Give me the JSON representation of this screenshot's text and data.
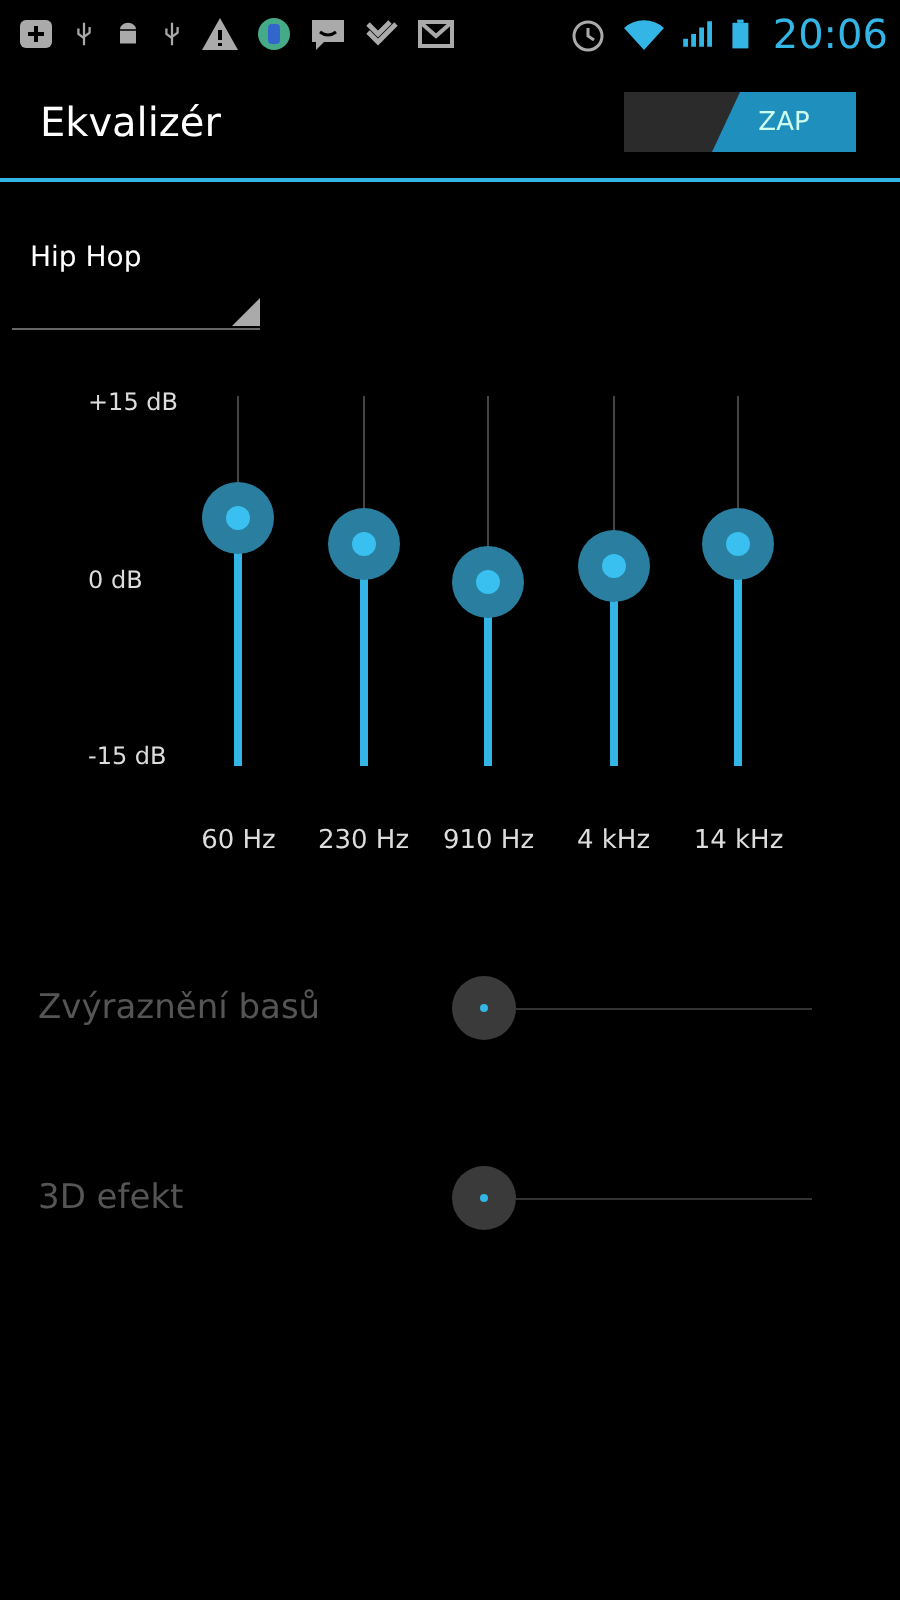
{
  "status_bar": {
    "time": "20:06"
  },
  "action_bar": {
    "title": "Ekvalizér",
    "toggle": {
      "label": "ZAP",
      "on": true
    }
  },
  "preset": {
    "value": "Hip Hop"
  },
  "equalizer": {
    "scale": [
      "+15 dB",
      "0 dB",
      "-15 dB"
    ],
    "bands": [
      {
        "label": "60 Hz",
        "level": 0.67
      },
      {
        "label": "230 Hz",
        "level": 0.6
      },
      {
        "label": "910 Hz",
        "level": 0.5
      },
      {
        "label": "4 kHz",
        "level": 0.54
      },
      {
        "label": "14 kHz",
        "level": 0.6
      }
    ]
  },
  "effects": [
    {
      "label": "Zvýraznění basů",
      "disabled": true
    },
    {
      "label": "3D efekt",
      "disabled": true
    }
  ]
}
